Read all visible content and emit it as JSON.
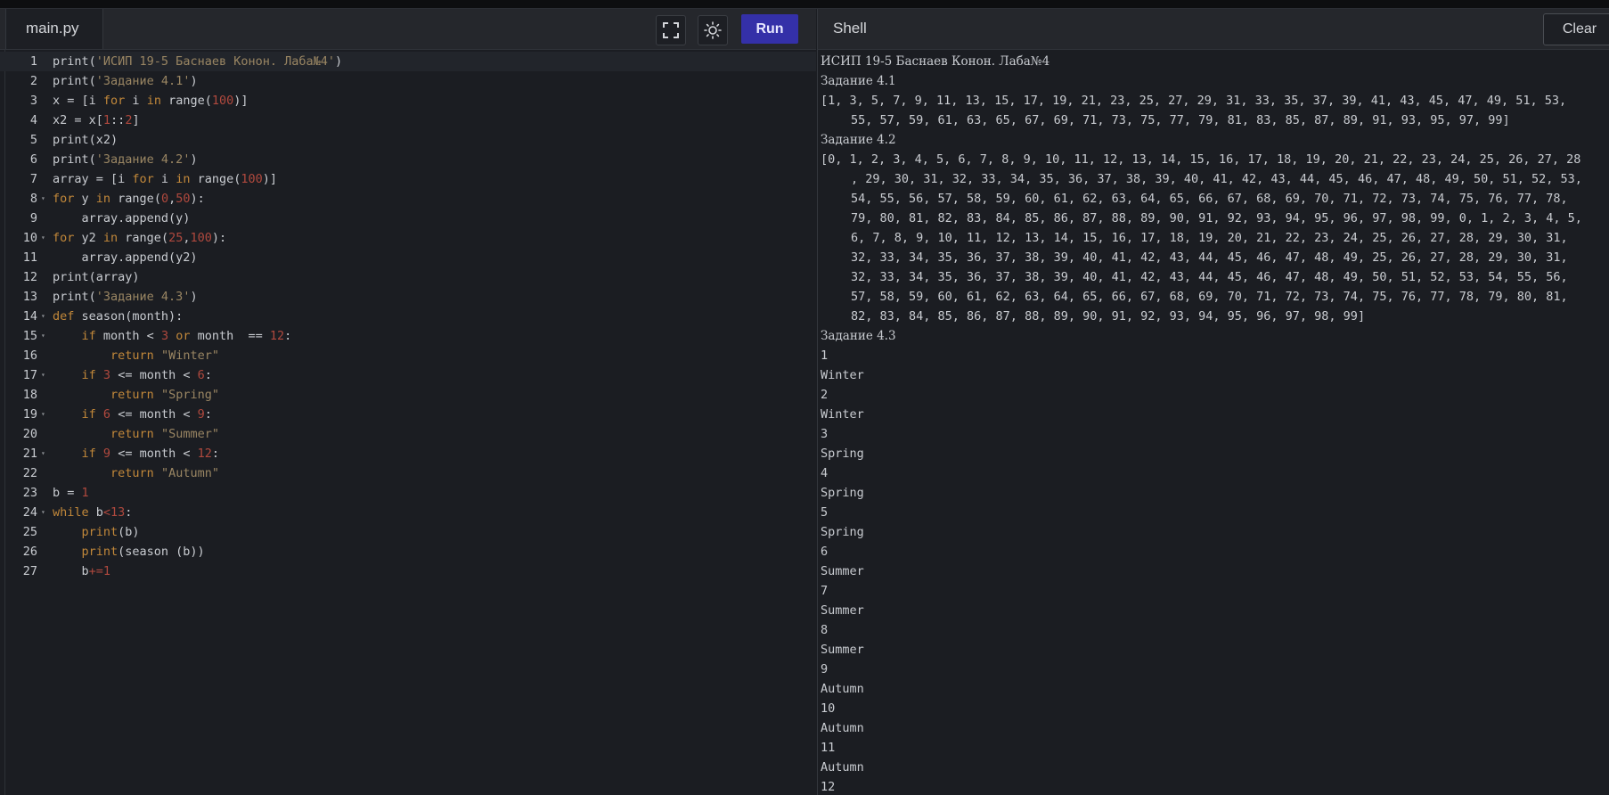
{
  "editor": {
    "tab_label": "main.py",
    "run_label": "Run",
    "lines": [
      [
        {
          "t": "print(",
          "c": "fn"
        },
        {
          "t": "'ИСИП 19-5 Баснаев Конон. Лаба№4'",
          "c": "str"
        },
        {
          "t": ")",
          "c": "fn"
        }
      ],
      [
        {
          "t": "print(",
          "c": "fn"
        },
        {
          "t": "'Задание 4.1'",
          "c": "str"
        },
        {
          "t": ")",
          "c": "fn"
        }
      ],
      [
        {
          "t": "x = [i ",
          "c": "fn"
        },
        {
          "t": "for",
          "c": "kw"
        },
        {
          "t": " i ",
          "c": "fn"
        },
        {
          "t": "in",
          "c": "kw"
        },
        {
          "t": " range(",
          "c": "fn"
        },
        {
          "t": "100",
          "c": "num"
        },
        {
          "t": ")]",
          "c": "fn"
        }
      ],
      [
        {
          "t": "x2 = x[",
          "c": "fn"
        },
        {
          "t": "1",
          "c": "num"
        },
        {
          "t": "::",
          "c": "fn"
        },
        {
          "t": "2",
          "c": "num"
        },
        {
          "t": "]",
          "c": "fn"
        }
      ],
      [
        {
          "t": "print(x2)",
          "c": "fn"
        }
      ],
      [
        {
          "t": "print(",
          "c": "fn"
        },
        {
          "t": "'Задание 4.2'",
          "c": "str"
        },
        {
          "t": ")",
          "c": "fn"
        }
      ],
      [
        {
          "t": "array = [i ",
          "c": "fn"
        },
        {
          "t": "for",
          "c": "kw"
        },
        {
          "t": " i ",
          "c": "fn"
        },
        {
          "t": "in",
          "c": "kw"
        },
        {
          "t": " range(",
          "c": "fn"
        },
        {
          "t": "100",
          "c": "num"
        },
        {
          "t": ")]",
          "c": "fn"
        }
      ],
      [
        {
          "t": "for",
          "c": "kw"
        },
        {
          "t": " y ",
          "c": "fn"
        },
        {
          "t": "in",
          "c": "kw"
        },
        {
          "t": " range(",
          "c": "fn"
        },
        {
          "t": "0",
          "c": "num"
        },
        {
          "t": ",",
          "c": "fn"
        },
        {
          "t": "50",
          "c": "num"
        },
        {
          "t": "):",
          "c": "fn"
        }
      ],
      [
        {
          "t": "    array.append(y)",
          "c": "fn"
        }
      ],
      [
        {
          "t": "for",
          "c": "kw"
        },
        {
          "t": " y2 ",
          "c": "fn"
        },
        {
          "t": "in",
          "c": "kw"
        },
        {
          "t": " range(",
          "c": "fn"
        },
        {
          "t": "25",
          "c": "num"
        },
        {
          "t": ",",
          "c": "fn"
        },
        {
          "t": "100",
          "c": "num"
        },
        {
          "t": "):",
          "c": "fn"
        }
      ],
      [
        {
          "t": "    array.append(y2)",
          "c": "fn"
        }
      ],
      [
        {
          "t": "print(array)",
          "c": "fn"
        }
      ],
      [
        {
          "t": "print(",
          "c": "fn"
        },
        {
          "t": "'Задание 4.3'",
          "c": "str"
        },
        {
          "t": ")",
          "c": "fn"
        }
      ],
      [
        {
          "t": "def",
          "c": "kw"
        },
        {
          "t": " season(month):",
          "c": "fn"
        }
      ],
      [
        {
          "t": "    ",
          "c": "fn"
        },
        {
          "t": "if",
          "c": "kw"
        },
        {
          "t": " month < ",
          "c": "fn"
        },
        {
          "t": "3",
          "c": "num"
        },
        {
          "t": " ",
          "c": "fn"
        },
        {
          "t": "or",
          "c": "kw"
        },
        {
          "t": " month  == ",
          "c": "fn"
        },
        {
          "t": "12",
          "c": "num"
        },
        {
          "t": ":",
          "c": "fn"
        }
      ],
      [
        {
          "t": "        ",
          "c": "fn"
        },
        {
          "t": "return",
          "c": "kw"
        },
        {
          "t": " ",
          "c": "fn"
        },
        {
          "t": "\"Winter\"",
          "c": "str"
        }
      ],
      [
        {
          "t": "    ",
          "c": "fn"
        },
        {
          "t": "if",
          "c": "kw"
        },
        {
          "t": " ",
          "c": "fn"
        },
        {
          "t": "3",
          "c": "num"
        },
        {
          "t": " <= month < ",
          "c": "fn"
        },
        {
          "t": "6",
          "c": "num"
        },
        {
          "t": ":",
          "c": "fn"
        }
      ],
      [
        {
          "t": "        ",
          "c": "fn"
        },
        {
          "t": "return",
          "c": "kw"
        },
        {
          "t": " ",
          "c": "fn"
        },
        {
          "t": "\"Spring\"",
          "c": "str"
        }
      ],
      [
        {
          "t": "    ",
          "c": "fn"
        },
        {
          "t": "if",
          "c": "kw"
        },
        {
          "t": " ",
          "c": "fn"
        },
        {
          "t": "6",
          "c": "num"
        },
        {
          "t": " <= month < ",
          "c": "fn"
        },
        {
          "t": "9",
          "c": "num"
        },
        {
          "t": ":",
          "c": "fn"
        }
      ],
      [
        {
          "t": "        ",
          "c": "fn"
        },
        {
          "t": "return",
          "c": "kw"
        },
        {
          "t": " ",
          "c": "fn"
        },
        {
          "t": "\"Summer\"",
          "c": "str"
        }
      ],
      [
        {
          "t": "    ",
          "c": "fn"
        },
        {
          "t": "if",
          "c": "kw"
        },
        {
          "t": " ",
          "c": "fn"
        },
        {
          "t": "9",
          "c": "num"
        },
        {
          "t": " <= month < ",
          "c": "fn"
        },
        {
          "t": "12",
          "c": "num"
        },
        {
          "t": ":",
          "c": "fn"
        }
      ],
      [
        {
          "t": "        ",
          "c": "fn"
        },
        {
          "t": "return",
          "c": "kw"
        },
        {
          "t": " ",
          "c": "fn"
        },
        {
          "t": "\"Autumn\"",
          "c": "str"
        }
      ],
      [
        {
          "t": "b = ",
          "c": "fn"
        },
        {
          "t": "1",
          "c": "num"
        }
      ],
      [
        {
          "t": "while",
          "c": "kw"
        },
        {
          "t": " b",
          "c": "fn"
        },
        {
          "t": "<13",
          "c": "num"
        },
        {
          "t": ":",
          "c": "fn"
        }
      ],
      [
        {
          "t": "    ",
          "c": "fn"
        },
        {
          "t": "print",
          "c": "kw"
        },
        {
          "t": "(b)",
          "c": "fn"
        }
      ],
      [
        {
          "t": "    ",
          "c": "fn"
        },
        {
          "t": "print",
          "c": "kw"
        },
        {
          "t": "(season (b))",
          "c": "fn"
        }
      ],
      [
        {
          "t": "    b",
          "c": "fn"
        },
        {
          "t": "+=1",
          "c": "num"
        }
      ]
    ],
    "fold_lines": [
      8,
      10,
      14,
      15,
      17,
      19,
      21,
      24
    ]
  },
  "shell": {
    "title": "Shell",
    "clear_label": "Clear",
    "lines": [
      {
        "t": "ИСИП 19-5 Баснаев Конон. Лаба№4",
        "serif": true
      },
      {
        "t": "Задание 4.1",
        "serif": true
      },
      {
        "t": "[1, 3, 5, 7, 9, 11, 13, 15, 17, 19, 21, 23, 25, 27, 29, 31, 33, 35, 37, 39, 41, 43, 45, 47, 49, 51, 53,"
      },
      {
        "t": "55, 57, 59, 61, 63, 65, 67, 69, 71, 73, 75, 77, 79, 81, 83, 85, 87, 89, 91, 93, 95, 97, 99]",
        "indent": true
      },
      {
        "t": "Задание 4.2",
        "serif": true
      },
      {
        "t": "[0, 1, 2, 3, 4, 5, 6, 7, 8, 9, 10, 11, 12, 13, 14, 15, 16, 17, 18, 19, 20, 21, 22, 23, 24, 25, 26, 27, 28"
      },
      {
        "t": ", 29, 30, 31, 32, 33, 34, 35, 36, 37, 38, 39, 40, 41, 42, 43, 44, 45, 46, 47, 48, 49, 50, 51, 52, 53,",
        "indent": true
      },
      {
        "t": "54, 55, 56, 57, 58, 59, 60, 61, 62, 63, 64, 65, 66, 67, 68, 69, 70, 71, 72, 73, 74, 75, 76, 77, 78,",
        "indent": true
      },
      {
        "t": "79, 80, 81, 82, 83, 84, 85, 86, 87, 88, 89, 90, 91, 92, 93, 94, 95, 96, 97, 98, 99, 0, 1, 2, 3, 4, 5,",
        "indent": true
      },
      {
        "t": "6, 7, 8, 9, 10, 11, 12, 13, 14, 15, 16, 17, 18, 19, 20, 21, 22, 23, 24, 25, 26, 27, 28, 29, 30, 31,",
        "indent": true
      },
      {
        "t": "32, 33, 34, 35, 36, 37, 38, 39, 40, 41, 42, 43, 44, 45, 46, 47, 48, 49, 25, 26, 27, 28, 29, 30, 31,",
        "indent": true
      },
      {
        "t": "32, 33, 34, 35, 36, 37, 38, 39, 40, 41, 42, 43, 44, 45, 46, 47, 48, 49, 50, 51, 52, 53, 54, 55, 56,",
        "indent": true
      },
      {
        "t": "57, 58, 59, 60, 61, 62, 63, 64, 65, 66, 67, 68, 69, 70, 71, 72, 73, 74, 75, 76, 77, 78, 79, 80, 81,",
        "indent": true
      },
      {
        "t": "82, 83, 84, 85, 86, 87, 88, 89, 90, 91, 92, 93, 94, 95, 96, 97, 98, 99]",
        "indent": true
      },
      {
        "t": "Задание 4.3",
        "serif": true
      },
      {
        "t": "1"
      },
      {
        "t": "Winter"
      },
      {
        "t": "2"
      },
      {
        "t": "Winter"
      },
      {
        "t": "3"
      },
      {
        "t": "Spring"
      },
      {
        "t": "4"
      },
      {
        "t": "Spring"
      },
      {
        "t": "5"
      },
      {
        "t": "Spring"
      },
      {
        "t": "6"
      },
      {
        "t": "Summer"
      },
      {
        "t": "7"
      },
      {
        "t": "Summer"
      },
      {
        "t": "8"
      },
      {
        "t": "Summer"
      },
      {
        "t": "9"
      },
      {
        "t": "Autumn"
      },
      {
        "t": "10"
      },
      {
        "t": "Autumn"
      },
      {
        "t": "11"
      },
      {
        "t": "Autumn"
      },
      {
        "t": "12"
      }
    ]
  },
  "icons": {
    "fullscreen": "fullscreen-icon",
    "theme": "sun-icon"
  }
}
